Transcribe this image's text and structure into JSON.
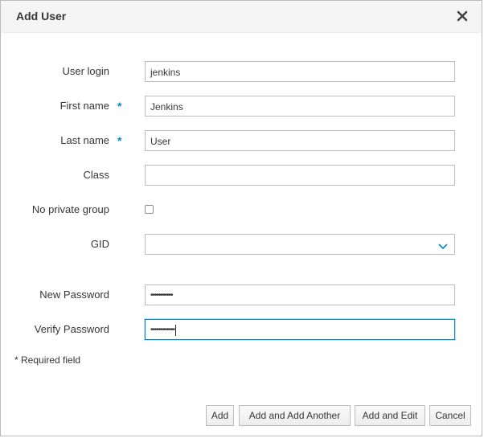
{
  "dialog": {
    "title": "Add User",
    "close_icon": "close-icon"
  },
  "form": {
    "user_login": {
      "label": "User login",
      "value": "jenkins",
      "required": false
    },
    "first_name": {
      "label": "First name",
      "value": "Jenkins",
      "required": true,
      "required_mark": "*"
    },
    "last_name": {
      "label": "Last name",
      "value": "User",
      "required": true,
      "required_mark": "*"
    },
    "class": {
      "label": "Class",
      "value": ""
    },
    "no_private_group": {
      "label": "No private group",
      "checked": false
    },
    "gid": {
      "label": "GID",
      "selected": "",
      "icon": "chevron-down-icon"
    },
    "new_password": {
      "label": "New Password",
      "masked_value": "•••••••••••"
    },
    "verify_password": {
      "label": "Verify Password",
      "masked_value": "••••••••••••",
      "focused": true
    }
  },
  "required_note": "* Required field",
  "buttons": {
    "add": "Add",
    "add_another": "Add and Add Another",
    "add_edit": "Add and Edit",
    "cancel": "Cancel"
  },
  "colors": {
    "accent": "#0088ce",
    "header_bg": "#f5f5f5",
    "border": "#bbbbbb"
  }
}
